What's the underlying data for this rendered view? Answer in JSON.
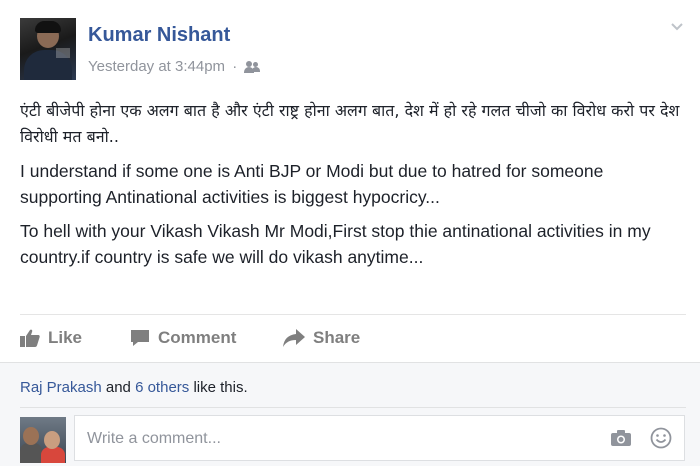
{
  "post": {
    "author": "Kumar Nishant",
    "timestamp": "Yesterday at 3:44pm",
    "separator": "·",
    "audience_icon": "friends-icon",
    "paragraphs": [
      "एंटी बीजेपी होना एक अलग बात है और एंटी राष्ट्र होना अलग बात, देश में हो रहे गलत चीजो का विरोध करो पर देश विरोधी मत बनो..",
      "I understand if some one is Anti BJP or Modi but due to hatred for someone supporting Antinational activities is biggest hypocricy...",
      "To hell with your Vikash Vikash Mr Modi,First stop thie antinational activities in my country.if country is safe we will do vikash anytime..."
    ]
  },
  "actions": {
    "like": "Like",
    "comment": "Comment",
    "share": "Share"
  },
  "likes": {
    "name": "Raj Prakash",
    "and": "and",
    "others": "6 others",
    "suffix": "like this."
  },
  "comment_input": {
    "placeholder": "Write a comment...",
    "value": ""
  },
  "colors": {
    "link": "#365899",
    "muted": "#90949c",
    "action": "#7f7f7f",
    "footer_bg": "#f6f7f9"
  }
}
